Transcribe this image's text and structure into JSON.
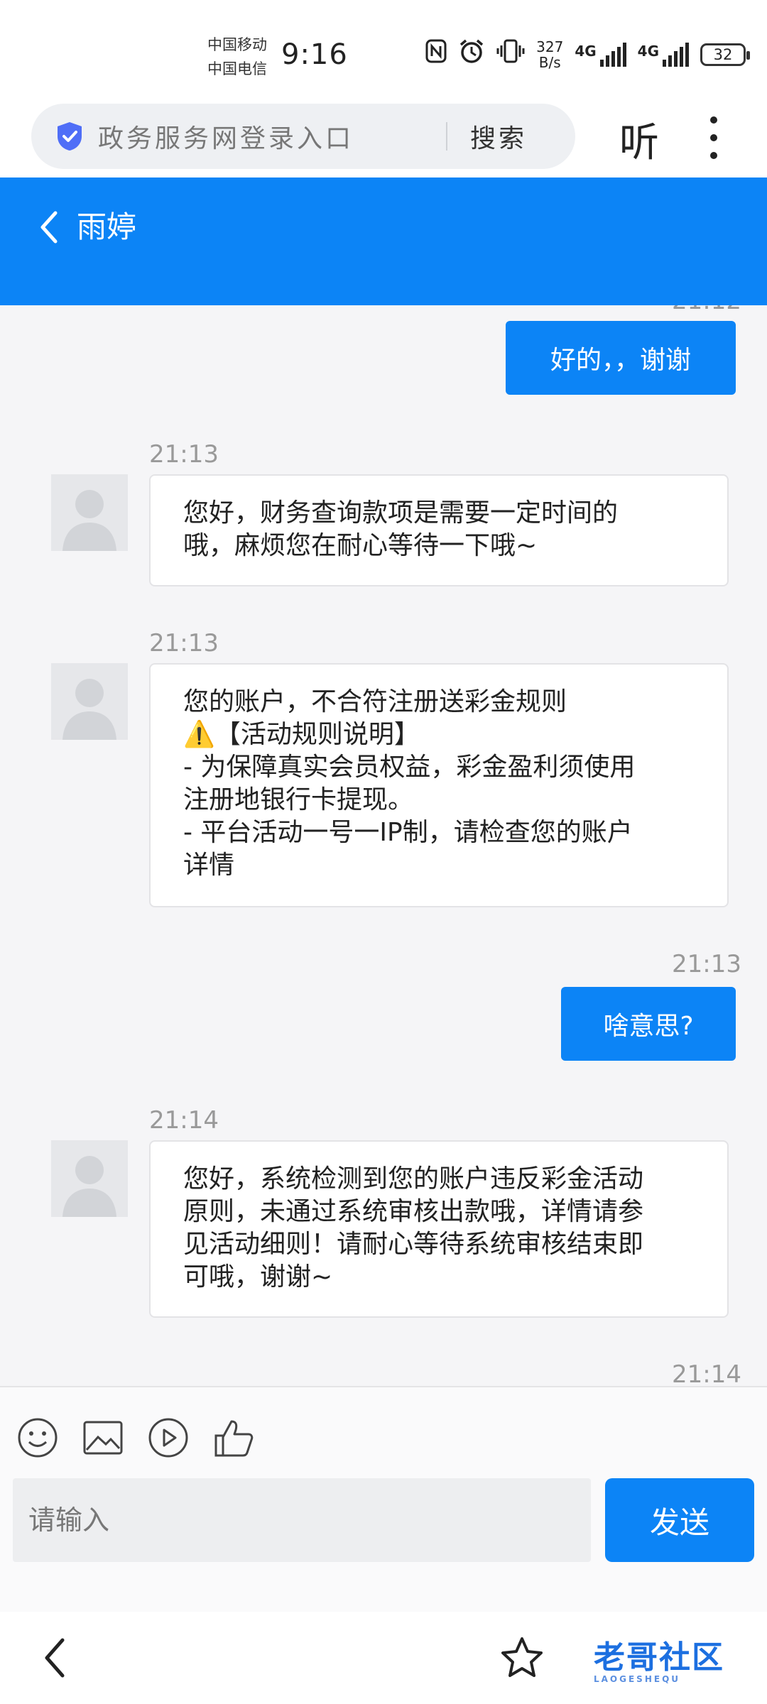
{
  "status_bar": {
    "carrier_1": "中国移动",
    "carrier_2": "中国电信",
    "time": "9:16",
    "net_speed_value": "327",
    "net_speed_unit": "B/s",
    "network_1": "4G",
    "network_2": "4G",
    "battery": "32",
    "icons": [
      "nfc-icon",
      "alarm-icon",
      "vibrate-icon",
      "signal-icon",
      "battery-icon"
    ]
  },
  "browser": {
    "search_text": "政务服务网登录入口",
    "search_button": "搜索",
    "listen_label": "听"
  },
  "chat": {
    "title": "雨婷",
    "accent_color": "#0c84f6",
    "messages": [
      {
        "direction": "out",
        "timestamp": "",
        "text": "好的，，谢谢"
      },
      {
        "direction": "in",
        "timestamp": "21:13",
        "text": "您好，财务查询款项是需要一定时间的\n哦，麻烦您在耐心等待一下哦~"
      },
      {
        "direction": "in",
        "timestamp": "21:13",
        "text": "您的账户，不合符注册送彩金规则\n⚠️【活动规则说明】\n- 为保障真实会员权益，彩金盈利须使用\n注册地银行卡提现。\n- 平台活动一号一IP制，请检查您的账户\n详情"
      },
      {
        "direction": "out",
        "timestamp": "21:13",
        "text": "啥意思?"
      },
      {
        "direction": "in",
        "timestamp": "21:14",
        "text": "您好，系统检测到您的账户违反彩金活动\n原则，未通过系统审核出款哦，详情请参\n见活动细则！请耐心等待系统审核结束即\n可哦，谢谢~"
      },
      {
        "direction": "out",
        "timestamp": "21:14",
        "text": ""
      }
    ]
  },
  "input": {
    "placeholder": "请输入",
    "send_label": "发送",
    "tools": [
      "emoji-icon",
      "image-icon",
      "video-icon",
      "like-icon"
    ]
  },
  "watermark": {
    "text": "老哥社区",
    "subtext": "LAOGESHEQU"
  }
}
